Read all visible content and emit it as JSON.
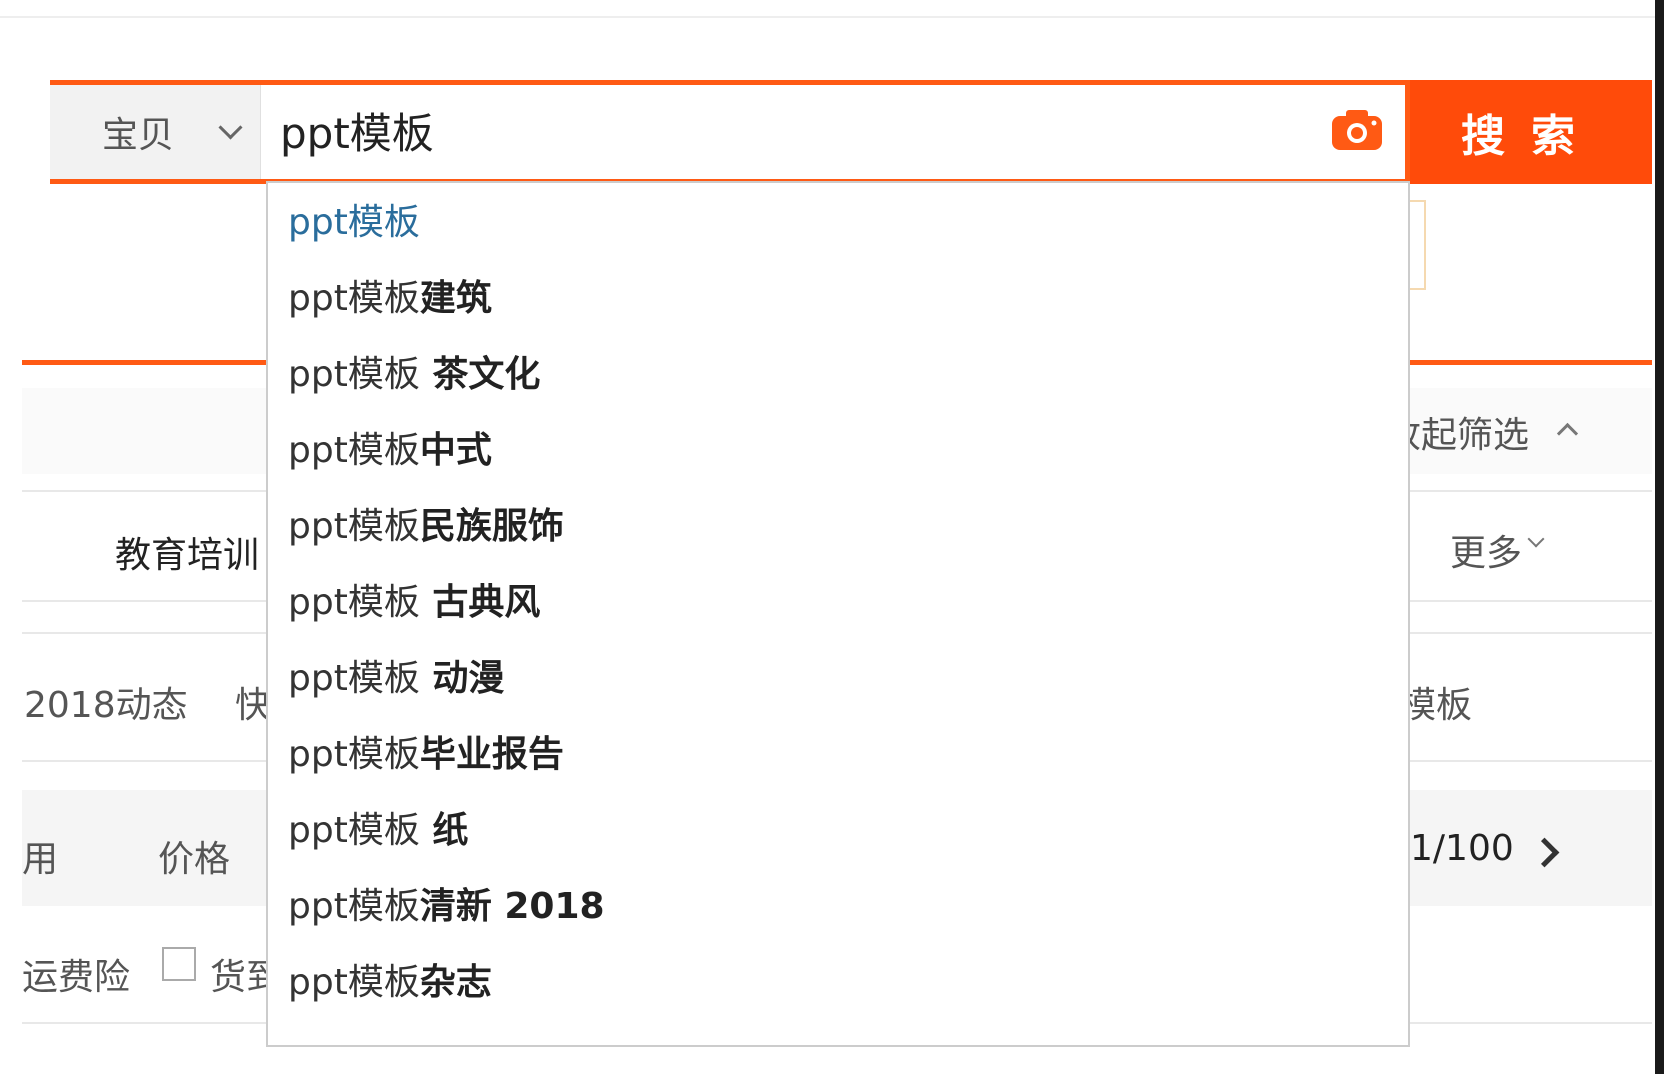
{
  "search": {
    "category_label": "宝贝",
    "query": "ppt模板",
    "button_label": "搜索"
  },
  "suggestions": [
    {
      "base": "ppt模板",
      "bold": ""
    },
    {
      "base": "ppt模板",
      "bold": "建筑"
    },
    {
      "base": "ppt模板",
      "bold": " 茶文化"
    },
    {
      "base": "ppt模板",
      "bold": "中式"
    },
    {
      "base": "ppt模板",
      "bold": "民族服饰"
    },
    {
      "base": "ppt模板",
      "bold": " 古典风"
    },
    {
      "base": "ppt模板",
      "bold": " 动漫"
    },
    {
      "base": "ppt模板",
      "bold": "毕业报告"
    },
    {
      "base": "ppt模板",
      "bold": " 纸"
    },
    {
      "base": "ppt模板",
      "bold": "清新 2018"
    },
    {
      "base": "ppt模板",
      "bold": "杂志"
    }
  ],
  "filters": {
    "collapse_label": "收起筛选",
    "category_partial": "教育培训",
    "more_label": "更多",
    "related_partial_left": "2018动态",
    "related_partial_left2": "快",
    "related_partial_right": "模板",
    "sort_partial": "用",
    "price_label": "价格",
    "page_indicator": "1/100",
    "shipping_insurance_label": "运费险",
    "cod_partial": "货到"
  },
  "colors": {
    "brand_orange": "#ff4b0a",
    "active_suggestion": "#2a6d9c"
  },
  "icons": {
    "camera": "camera-icon",
    "category_chevron": "chevron-down-icon",
    "collapse_chevron": "chevron-up-icon",
    "next_page": "chevron-right-icon"
  }
}
